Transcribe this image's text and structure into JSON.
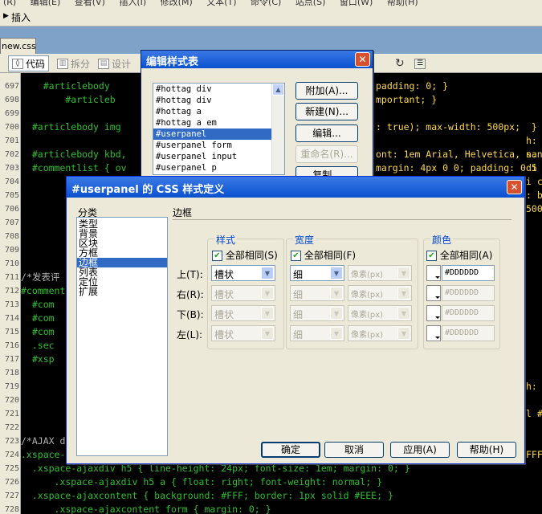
{
  "menubar": {
    "text": "(R) 编辑(E) 查看(V) 插入(I) 修改(M) 文本(T) 命令(C) 站点(S) 窗口(W) 帮助(H)"
  },
  "insertbar": {
    "label": "插入"
  },
  "file_tab": {
    "label": "new.css"
  },
  "toolbar": {
    "code": "代码",
    "split": "拆分",
    "design": "设计"
  },
  "editor": {
    "lines": [
      {
        "n": "697",
        "t": "    #articlebody",
        "t2": "padding: 0; }",
        "cls": "c-sel"
      },
      {
        "n": "698",
        "t": "        #articleb",
        "t2": "mportant; }",
        "cls": "c-sel"
      },
      {
        "n": "699",
        "t": "",
        "t2": "",
        "cls": "c-sel"
      },
      {
        "n": "700",
        "t": "  #articlebody img",
        "t2": ": true); max-width: 500px;  }",
        "cls": "c-sel"
      },
      {
        "n": "701",
        "t": "",
        "t2": "",
        "cls": "c-sel"
      },
      {
        "n": "702",
        "t": "  #articlebody kbd,",
        "t2": "ont: 1em Arial, Helvetica, sans",
        "cls": "c-sel"
      },
      {
        "n": "703",
        "t": "  #commentlist { ov",
        "t2": "margin: 4px 0 0; padding: 0 5",
        "cls": "c-sel"
      },
      {
        "n": "704",
        "t": "",
        "t2": "",
        "cls": "c-sel"
      },
      {
        "n": "705",
        "t": "",
        "t2": "",
        "cls": "c-sel"
      },
      {
        "n": "706",
        "t": "",
        "t2": "",
        "cls": "c-sel"
      },
      {
        "n": "707",
        "t": "",
        "t2": "",
        "cls": "c-sel"
      },
      {
        "n": "708",
        "t": "",
        "t2": "",
        "cls": "c-sel"
      },
      {
        "n": "709",
        "t": "",
        "t2": "",
        "cls": "c-sel"
      },
      {
        "n": "710",
        "t": "",
        "t2": "",
        "cls": "c-sel"
      },
      {
        "n": "711",
        "t": "/*发表评",
        "t2": "",
        "cls": "c-cmt"
      },
      {
        "n": "712",
        "t": "#comment",
        "t2": "",
        "cls": "c-sel"
      },
      {
        "n": "713",
        "t": "  #com",
        "t2": "",
        "cls": "c-sel"
      },
      {
        "n": "714",
        "t": "  #com",
        "t2": "",
        "cls": "c-sel"
      },
      {
        "n": "715",
        "t": "  #com",
        "t2": "",
        "cls": "c-sel"
      },
      {
        "n": "716",
        "t": "  .sec",
        "t2": "",
        "cls": "c-sel"
      },
      {
        "n": "717",
        "t": "  #xsp",
        "t2": "",
        "cls": "c-sel"
      },
      {
        "n": "718",
        "t": "",
        "t2": "",
        "cls": "c-sel"
      },
      {
        "n": "719",
        "t": "",
        "t2": "",
        "cls": "c-sel"
      },
      {
        "n": "720",
        "t": "",
        "t2": "",
        "cls": "c-sel"
      },
      {
        "n": "721",
        "t": "",
        "t2": "",
        "cls": "c-sel"
      },
      {
        "n": "722",
        "t": "",
        "t2": "",
        "cls": "c-sel"
      },
      {
        "n": "723",
        "t": "/*AJAX d",
        "t2": "",
        "cls": "c-cmt"
      },
      {
        "n": "724",
        "t": ".xspace-",
        "t2": "",
        "cls": "c-sel"
      },
      {
        "n": "725",
        "t": "  .xspace-ajaxdiv h5 { line-height: 24px; font-size: 1em; margin: 0; }",
        "t2": "",
        "cls": "c-sel"
      },
      {
        "n": "726",
        "t": "      .xspace-ajaxdiv h5 a { float: right; font-weight: normal; }",
        "t2": "",
        "cls": "c-sel"
      },
      {
        "n": "727",
        "t": "  .xspace-ajaxcontent { background: #FFF; border: 1px solid #EEE; }",
        "t2": "",
        "cls": "c-sel"
      },
      {
        "n": "728",
        "t": "      .xspace-ajaxcontent form { margin: 0; }",
        "t2": "",
        "cls": "c-sel"
      }
    ],
    "right_frag": [
      {
        "row": 4,
        "t": "h:"
      },
      {
        "row": 5,
        "t": "n."
      },
      {
        "row": 6,
        "t": "di"
      },
      {
        "row": 7,
        "t": "i c"
      },
      {
        "row": 22,
        "t": "h:"
      },
      {
        "row": 24,
        "t": "l #"
      },
      {
        "row": 27,
        "t": "FFF"
      },
      {
        "row": 8,
        "t": ": b"
      },
      {
        "row": 9,
        "t": "500"
      }
    ]
  },
  "stylesheet_dialog": {
    "title": "编辑样式表",
    "items": [
      "#hottag div",
      "#hottag div",
      "#hottag a",
      "#hottag a em",
      "#userpanel",
      "#userpanel form",
      "#userpanel input",
      "#userpanel p"
    ],
    "selected_index": 4,
    "buttons": {
      "attach": "附加(A)...",
      "new": "新建(N)...",
      "edit": "编辑...",
      "rename": "重命名(R)...",
      "dup": "复制..."
    }
  },
  "css_dialog": {
    "title": "#userpanel 的 CSS 样式定义",
    "category_header": "分类",
    "categories": [
      "类型",
      "背景",
      "区块",
      "方框",
      "边框",
      "列表",
      "定位",
      "扩展"
    ],
    "selected_category": 4,
    "section_title": "边框",
    "groups": {
      "style": "样式",
      "width": "宽度",
      "color": "颜色"
    },
    "same_all": {
      "style": "全部相同(S)",
      "width": "全部相同(F)",
      "color": "全部相同(A)"
    },
    "rows": [
      {
        "label": "上(T):",
        "style": "槽状",
        "width": "细",
        "unit": "像素(px)",
        "color": "#DDDDDD",
        "enabled": true
      },
      {
        "label": "右(R):",
        "style": "槽状",
        "width": "细",
        "unit": "像素(px)",
        "color": "#DDDDDD",
        "enabled": false
      },
      {
        "label": "下(B):",
        "style": "槽状",
        "width": "细",
        "unit": "像素(px)",
        "color": "#DDDDDD",
        "enabled": false
      },
      {
        "label": "左(L):",
        "style": "槽状",
        "width": "细",
        "unit": "像素(px)",
        "color": "#DDDDDD",
        "enabled": false
      }
    ],
    "buttons": {
      "ok": "确定",
      "cancel": "取消",
      "apply": "应用(A)",
      "help": "帮助(H)"
    }
  },
  "colors": {
    "editor_bg": "#000000",
    "selector": "#2fc02f",
    "value": "#ffd84a",
    "titlebar": "#0a51cf",
    "selection": "#316ac5"
  }
}
